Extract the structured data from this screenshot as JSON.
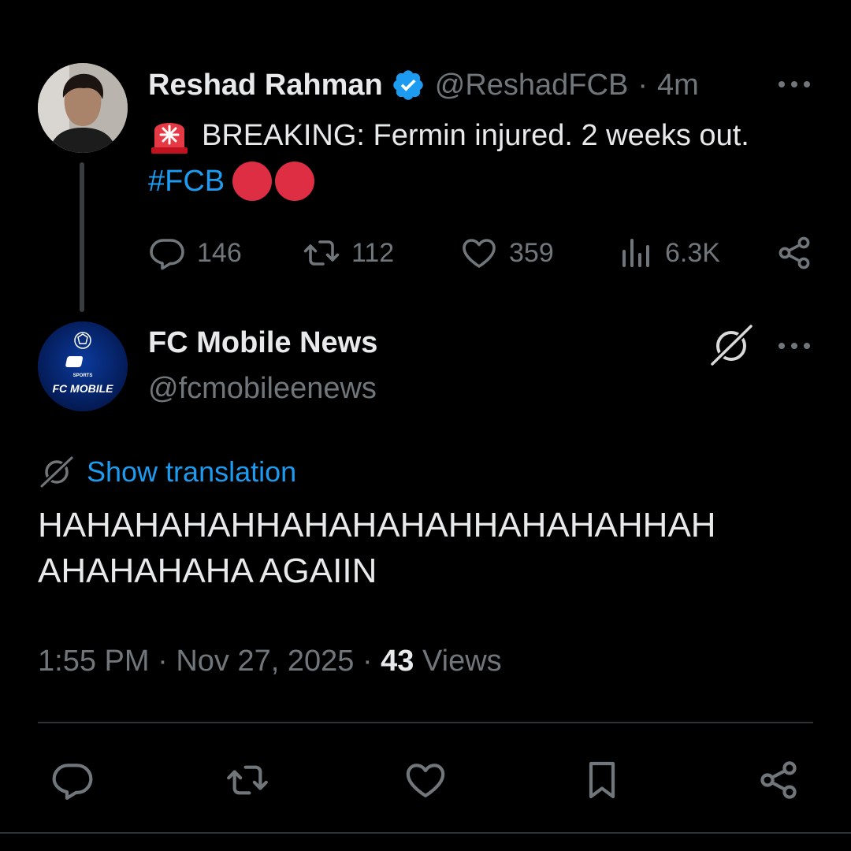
{
  "parent_tweet": {
    "name": "Reshad Rahman",
    "handle": "@ReshadFCB",
    "separator": "·",
    "time": "4m",
    "text_line1": "BREAKING: Fermin injured. 2 weeks out.",
    "hashtag": "#FCB",
    "stats": {
      "replies": "146",
      "reposts": "112",
      "likes": "359",
      "views": "6.3K"
    }
  },
  "reply_tweet": {
    "name": "FC Mobile News",
    "handle": "@fcmobileenews",
    "avatar_text": "FC MOBILE",
    "show_translation": "Show translation",
    "text_line1": "HAHAHAHAHHAHAHAHAHHAHAHAHHAH",
    "text_line2": "AHAHAHAHA AGAIIN",
    "time": "1:55 PM",
    "separator": "·",
    "date": "Nov 27, 2025",
    "views_count": "43",
    "views_label": "Views"
  },
  "icons": {
    "more": "more-icon",
    "verified": "verified-badge-icon",
    "siren": "siren-emoji-icon",
    "reply": "reply-icon",
    "repost": "repost-icon",
    "like": "like-icon",
    "views": "views-icon",
    "share": "share-icon",
    "bookmark": "bookmark-icon",
    "grok": "grok-icon"
  },
  "colors": {
    "background": "#000000",
    "text": "#e7e9ea",
    "muted": "#71767b",
    "accent": "#1d9bf0",
    "red_circle": "#dd2e44"
  }
}
